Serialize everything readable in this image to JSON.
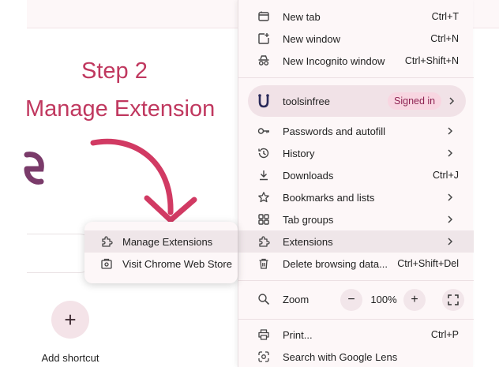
{
  "page": {
    "step_title": "Step 2",
    "step_subtitle": "Manage Extension",
    "add_shortcut_label": "Add shortcut",
    "add_shortcut_icon": "plus"
  },
  "menu": {
    "items": [
      {
        "label": "New tab",
        "shortcut": "Ctrl+T",
        "icon": "new-tab-icon"
      },
      {
        "label": "New window",
        "shortcut": "Ctrl+N",
        "icon": "new-window-icon"
      },
      {
        "label": "New Incognito window",
        "shortcut": "Ctrl+Shift+N",
        "icon": "incognito-icon"
      }
    ],
    "profile": {
      "name": "toolsinfree",
      "status": "Signed in"
    },
    "items2": [
      {
        "label": "Passwords and autofill",
        "icon": "key-icon"
      },
      {
        "label": "History",
        "icon": "history-icon"
      },
      {
        "label": "Downloads",
        "shortcut": "Ctrl+J",
        "icon": "download-icon"
      },
      {
        "label": "Bookmarks and lists",
        "icon": "star-icon"
      },
      {
        "label": "Tab groups",
        "icon": "tab-groups-icon"
      },
      {
        "label": "Extensions",
        "icon": "extensions-icon"
      },
      {
        "label": "Delete browsing data...",
        "shortcut": "Ctrl+Shift+Del",
        "icon": "trash-icon"
      }
    ],
    "zoom": {
      "label": "Zoom",
      "value": "100%",
      "minus": "−",
      "plus": "+"
    },
    "items3": [
      {
        "label": "Print...",
        "shortcut": "Ctrl+P",
        "icon": "print-icon"
      },
      {
        "label": "Search with Google Lens",
        "icon": "lens-icon"
      }
    ]
  },
  "submenu": {
    "items": [
      {
        "label": "Manage Extensions",
        "icon": "extensions-icon"
      },
      {
        "label": "Visit Chrome Web Store",
        "icon": "web-store-icon"
      }
    ]
  },
  "colors": {
    "accent": "#c0385f",
    "menu_bg": "#fdf7f8",
    "hover_bg": "#efe6e9",
    "badge_bg": "#f8d6e1",
    "badge_text": "#8f2352"
  }
}
